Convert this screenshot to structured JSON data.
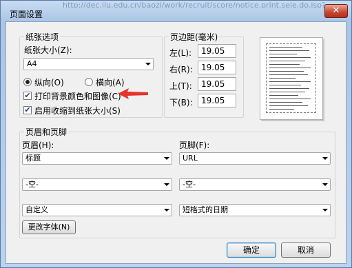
{
  "window": {
    "title": "页面设置",
    "background_url": "http://dec.jlu.edu.cn/baozi/work/recruit/score/notice.print.sele.do.jsp?site"
  },
  "paper": {
    "group_label": "纸张选项",
    "size_label": "纸张大小(Z):",
    "size_value": "A4",
    "portrait_label": "纵向(O)",
    "landscape_label": "横向(A)",
    "orientation_selected": "portrait",
    "print_background_label": "打印背景颜色和图像(C)",
    "print_background_checked": true,
    "shrink_to_fit_label": "启用收缩到纸张大小(S)",
    "shrink_to_fit_checked": true
  },
  "margins": {
    "group_label": "页边距(毫米)",
    "left_label": "左(L):",
    "left_value": "19.05",
    "right_label": "右(R):",
    "right_value": "19.05",
    "top_label": "上(T):",
    "top_value": "19.05",
    "bottom_label": "下(B):",
    "bottom_value": "19.05"
  },
  "header_footer": {
    "group_label": "页眉和页脚",
    "header_label": "页眉(H):",
    "footer_label": "页脚(F):",
    "header_1": "标题",
    "header_2": "-空-",
    "header_3": "自定义",
    "footer_1": "URL",
    "footer_2": "-空-",
    "footer_3": "短格式的日期",
    "change_font_label": "更改字体(N)"
  },
  "buttons": {
    "ok_label": "确定",
    "cancel_label": "取消"
  },
  "colors": {
    "annotation_arrow": "#e8322c",
    "title_bar": "#b8d0ec",
    "close_button": "#c8452f"
  }
}
